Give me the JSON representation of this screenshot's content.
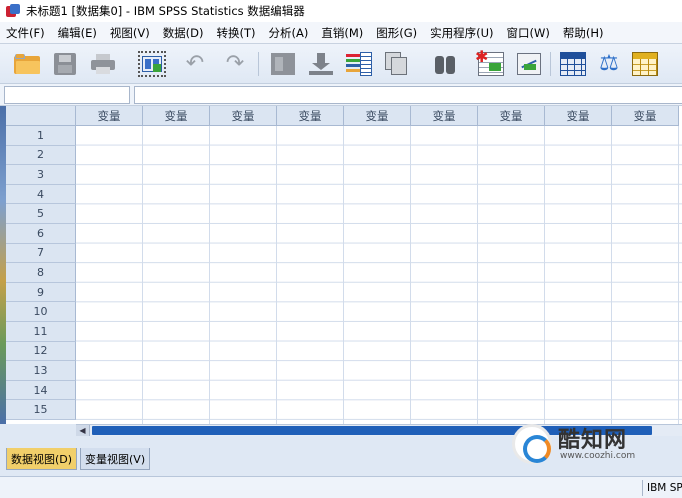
{
  "window": {
    "title": "未标题1 [数据集0] - IBM SPSS Statistics 数据编辑器",
    "icon": "spss-app-icon"
  },
  "menubar": {
    "items": [
      {
        "label": "文件(F)"
      },
      {
        "label": "编辑(E)"
      },
      {
        "label": "视图(V)"
      },
      {
        "label": "数据(D)"
      },
      {
        "label": "转换(T)"
      },
      {
        "label": "分析(A)"
      },
      {
        "label": "直销(M)"
      },
      {
        "label": "图形(G)"
      },
      {
        "label": "实用程序(U)"
      },
      {
        "label": "窗口(W)"
      },
      {
        "label": "帮助(H)"
      }
    ]
  },
  "toolbar": {
    "icons": [
      "open-folder-icon",
      "save-icon",
      "print-icon",
      "recall-dialog-icon",
      "undo-icon",
      "redo-icon",
      "goto-case-icon",
      "goto-variable-icon",
      "variables-icon",
      "run-descriptives-icon",
      "find-icon",
      "insert-cases-icon",
      "insert-variable-icon",
      "split-file-icon",
      "weight-cases-icon",
      "select-cases-icon"
    ]
  },
  "grid": {
    "column_header": "变量",
    "column_count": 9,
    "rows": [
      "1",
      "2",
      "3",
      "4",
      "5",
      "6",
      "7",
      "8",
      "9",
      "10",
      "11",
      "12",
      "13",
      "14",
      "15"
    ]
  },
  "tabs": {
    "data_view": "数据视图(D)",
    "variable_view": "变量视图(V)",
    "active": "data_view"
  },
  "watermark": {
    "name": "酷知网",
    "url": "www.coozhi.com"
  },
  "statusbar": {
    "text": "IBM SPSS Statistics 处理程序就绪"
  }
}
